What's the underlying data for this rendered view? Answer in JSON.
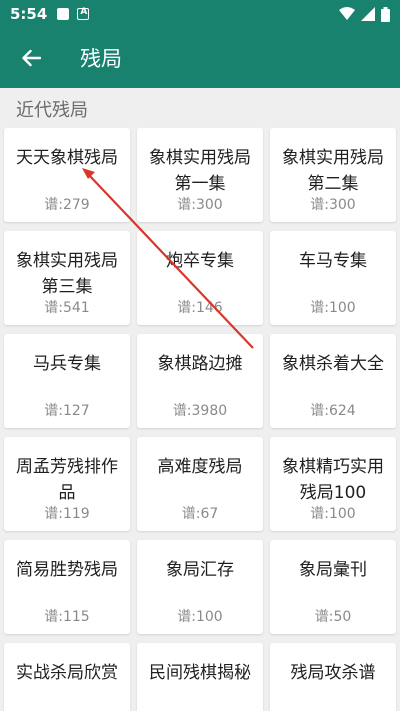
{
  "status_bar": {
    "time": "5:54"
  },
  "app_bar": {
    "title": "残局"
  },
  "section": {
    "title": "近代残局"
  },
  "cards": [
    {
      "title": "天天象棋残局",
      "count": "谱:279"
    },
    {
      "title": "象棋实用残局第一集",
      "count": "谱:300"
    },
    {
      "title": "象棋实用残局第二集",
      "count": "谱:300"
    },
    {
      "title": "象棋实用残局第三集",
      "count": "谱:541"
    },
    {
      "title": "炮卒专集",
      "count": "谱:146"
    },
    {
      "title": "车马专集",
      "count": "谱:100"
    },
    {
      "title": "马兵专集",
      "count": "谱:127"
    },
    {
      "title": "象棋路边摊",
      "count": "谱:3980"
    },
    {
      "title": "象棋杀着大全",
      "count": "谱:624"
    },
    {
      "title": "周孟芳残排作品",
      "count": "谱:119"
    },
    {
      "title": "高难度残局",
      "count": "谱:67"
    },
    {
      "title": "象棋精巧实用残局100",
      "count": "谱:100"
    },
    {
      "title": "简易胜势残局",
      "count": "谱:115"
    },
    {
      "title": "象局汇存",
      "count": "谱:100"
    },
    {
      "title": "象局彙刊",
      "count": "谱:50"
    },
    {
      "title": "实战杀局欣赏",
      "count": ""
    },
    {
      "title": "民间残棋揭秘",
      "count": ""
    },
    {
      "title": "残局攻杀谱",
      "count": ""
    }
  ],
  "colors": {
    "primary": "#18826e",
    "annotation_arrow": "#d9362b"
  },
  "icons": [
    "image-icon",
    "a-badge-icon",
    "wifi-icon",
    "signal-icon",
    "battery-icon",
    "back-arrow-icon"
  ]
}
